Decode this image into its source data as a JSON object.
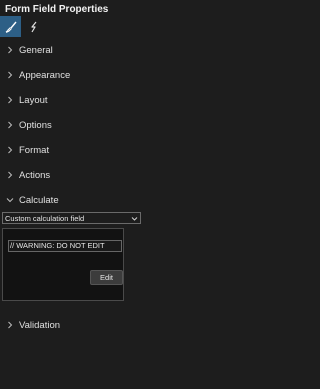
{
  "panel": {
    "title": "Form Field Properties",
    "tabs": [
      {
        "icon": "brush-icon",
        "active": true
      },
      {
        "icon": "lightning-icon",
        "active": false
      }
    ],
    "accent_color": "#2d5f86"
  },
  "sections": {
    "general": {
      "label": "General",
      "expanded": false
    },
    "appearance": {
      "label": "Appearance",
      "expanded": false
    },
    "layout": {
      "label": "Layout",
      "expanded": false
    },
    "options": {
      "label": "Options",
      "expanded": false
    },
    "format": {
      "label": "Format",
      "expanded": false
    },
    "actions": {
      "label": "Actions",
      "expanded": false
    },
    "calculate": {
      "label": "Calculate",
      "expanded": true
    },
    "validation": {
      "label": "Validation",
      "expanded": false
    }
  },
  "calculate": {
    "mode_selected": "Custom calculation field",
    "script_value": "// WARNING: DO NOT EDIT",
    "edit_label": "Edit"
  }
}
